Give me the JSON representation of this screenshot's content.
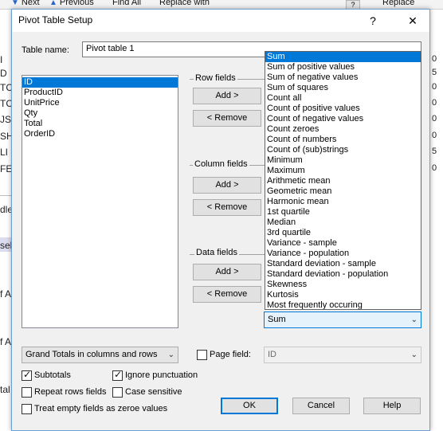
{
  "background": {
    "toolbar": {
      "next_label": "Next",
      "previous_label": "Previous",
      "find_all_label": "Find All",
      "replace_with_label": "Replace with",
      "replace_label": "Replace"
    },
    "left_fragments": [
      "I",
      "D",
      "TC",
      "TC",
      "JS",
      "SH",
      "LI",
      "FE",
      "dle",
      "sel",
      "f A",
      "f A",
      "tal"
    ],
    "right_fragments": [
      "0",
      "5",
      "0",
      "0",
      "0",
      "0",
      "5",
      "0"
    ]
  },
  "dialog": {
    "title": "Pivot Table Setup",
    "help_glyph": "?",
    "close_glyph": "✕",
    "table_name_label": "Table name:",
    "table_name_value": "Pivot table 1",
    "fields": [
      "ID",
      "ProductID",
      "UnitPrice",
      "Qty",
      "Total",
      "OrderID"
    ],
    "selected_field": "ID",
    "row_fields_label": "Row fields",
    "column_fields_label": "Column fields",
    "data_fields_label": "Data fields",
    "add_label": "Add >",
    "remove_label": "< Remove",
    "aggregate_options": [
      "Sum",
      "Sum of positive values",
      "Sum of negative values",
      "Sum of squares",
      "Count all",
      "Count of positive values",
      "Count of negative values",
      "Count zeroes",
      "Count of numbers",
      "Count of (sub)strings",
      "Minimum",
      "Maximum",
      "Arithmetic mean",
      "Geometric mean",
      "Harmonic mean",
      "1st quartile",
      "Median",
      "3rd quartile",
      "Variance - sample",
      "Variance - population",
      "Standard deviation - sample",
      "Standard deviation - population",
      "Skewness",
      "Kurtosis",
      "Most frequently occuring"
    ],
    "aggregate_selected": "Sum",
    "grand_totals_value": "Grand Totals in columns and rows",
    "page_field_label": "Page field:",
    "page_field_checked": false,
    "page_field_value": "ID",
    "checkboxes": {
      "subtotals": {
        "label": "Subtotals",
        "checked": true
      },
      "ignore_punctuation": {
        "label": "Ignore punctuation",
        "checked": true
      },
      "repeat_rows_fields": {
        "label": "Repeat rows fields",
        "checked": false
      },
      "case_sensitive": {
        "label": "Case sensitive",
        "checked": false
      },
      "treat_empty_zero": {
        "label": "Treat empty fields as zeroe values",
        "checked": false
      }
    },
    "ok_label": "OK",
    "cancel_label": "Cancel",
    "help_label": "Help"
  },
  "colors": {
    "selection": "#0078d7",
    "dialog_border": "#6d9fd3"
  },
  "icons": {
    "dropdown": "chevron-down-icon",
    "check": "checkmark-icon"
  }
}
